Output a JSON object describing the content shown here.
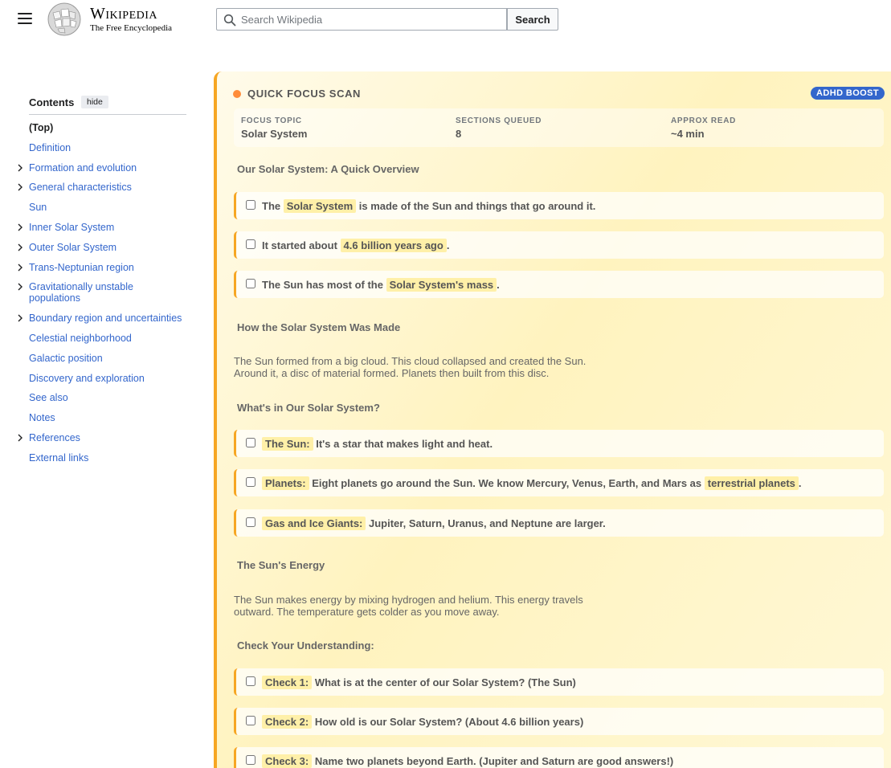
{
  "header": {
    "wordmark_title": "Wikipedia",
    "wordmark_tagline": "The Free Encyclopedia",
    "search_placeholder": "Search Wikipedia",
    "search_button": "Search"
  },
  "toc": {
    "title": "Contents",
    "hide_label": "hide",
    "items": [
      {
        "label": "(Top)",
        "toggle": false
      },
      {
        "label": "Definition",
        "toggle": false
      },
      {
        "label": "Formation and evolution",
        "toggle": true
      },
      {
        "label": "General characteristics",
        "toggle": true
      },
      {
        "label": "Sun",
        "toggle": false
      },
      {
        "label": "Inner Solar System",
        "toggle": true
      },
      {
        "label": "Outer Solar System",
        "toggle": true
      },
      {
        "label": "Trans-Neptunian region",
        "toggle": true
      },
      {
        "label": "Gravitationally unstable populations",
        "toggle": true
      },
      {
        "label": "Boundary region and uncertainties",
        "toggle": true
      },
      {
        "label": "Celestial neighborhood",
        "toggle": false
      },
      {
        "label": "Galactic position",
        "toggle": false
      },
      {
        "label": "Discovery and exploration",
        "toggle": false
      },
      {
        "label": "See also",
        "toggle": false
      },
      {
        "label": "Notes",
        "toggle": false
      },
      {
        "label": "References",
        "toggle": true
      },
      {
        "label": "External links",
        "toggle": false
      }
    ]
  },
  "panel": {
    "title": "QUICK FOCUS SCAN",
    "badge": "ADHD BOOST",
    "accent_color": "#f6a623",
    "stats": [
      {
        "label": "FOCUS TOPIC",
        "value": "Solar System"
      },
      {
        "label": "SECTIONS QUEUED",
        "value": "8"
      },
      {
        "label": "APPROX READ",
        "value": "~4 min"
      }
    ],
    "sections": {
      "overview": "Our Solar System: A Quick Overview",
      "made": "How the Solar System Was Made",
      "whats_in": "What's in Our Solar System?",
      "energy": "The Sun's Energy",
      "check": "Check Your Understanding:"
    },
    "overview_items": [
      {
        "pre": "The",
        "hl": "Solar System",
        "post": "is made of the Sun and things that go around it."
      },
      {
        "pre": "It started about",
        "hl": "4.6 billion years ago",
        "post": "."
      },
      {
        "pre": "The Sun has most of the",
        "hl": "Solar System's mass",
        "post": "."
      }
    ],
    "made_text": "The Sun formed from a big cloud. This cloud collapsed and created the Sun. Around it, a disc of material formed. Planets then built from this disc.",
    "whats_in_items": [
      {
        "hl": "The Sun:",
        "post": "It's a star that makes light and heat."
      },
      {
        "hl": "Planets:",
        "post": "Eight planets go around the Sun. We know Mercury, Venus, Earth, and Mars as",
        "hl2": "terrestrial planets",
        "post2": "."
      },
      {
        "hl": "Gas and Ice Giants:",
        "post": "Jupiter, Saturn, Uranus, and Neptune are larger."
      }
    ],
    "energy_text": "The Sun makes energy by mixing hydrogen and helium. This energy travels outward. The temperature gets colder as you move away.",
    "check_items": [
      {
        "hl": "Check 1:",
        "post": "What is at the center of our Solar System? (The Sun)"
      },
      {
        "hl": "Check 2:",
        "post": "How old is our Solar System? (About 4.6 billion years)"
      },
      {
        "hl": "Check 3:",
        "post": "Name two planets beyond Earth. (Jupiter and Saturn are good answers!)"
      }
    ]
  }
}
